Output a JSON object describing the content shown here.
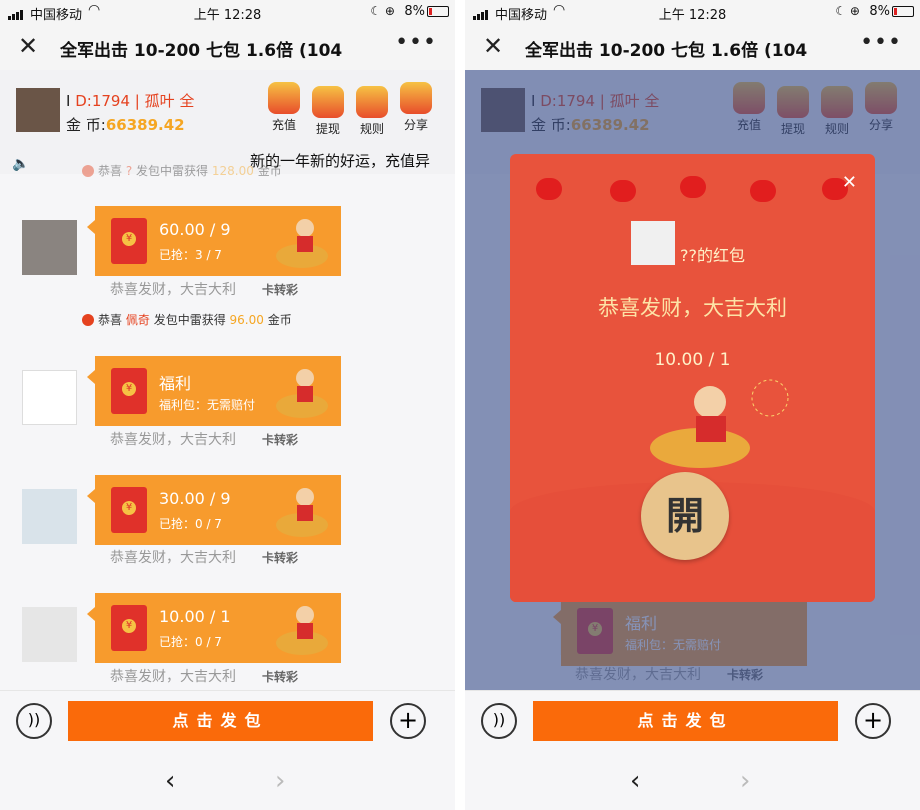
{
  "status": {
    "carrier": "中国移动",
    "time": "上午 12:28",
    "battery": "8%"
  },
  "header": {
    "title": "全军出击 10-200 七包 1.6倍 (104",
    "close_icon": "close-icon",
    "more_icon": "more-dots-icon"
  },
  "user": {
    "id_label": "I",
    "id_text": "D:1794 | 孤叶 全",
    "coins_label": "金 币:",
    "coins_value": "66389.42"
  },
  "toolbar": [
    {
      "label": "充值",
      "icon": "recharge-icon"
    },
    {
      "label": "提现",
      "icon": "withdraw-icon"
    },
    {
      "label": "规则",
      "icon": "rules-icon"
    },
    {
      "label": "分享",
      "icon": "share-icon"
    }
  ],
  "marquee": "新的一年新的好运，充值异",
  "notice_top": {
    "prefix": "恭喜",
    "name": "?",
    "mid": "发包中雷获得",
    "amount": "128.00",
    "unit": "金币"
  },
  "messages": [
    {
      "main": "60.00 / 9",
      "sub": "已抢：3 / 7",
      "foot": "恭喜发财，大吉大利",
      "wm": "卡转彩"
    },
    {
      "main": "福利",
      "sub": "福利包：无需赔付",
      "foot": "恭喜发财，大吉大利",
      "wm": "卡转彩"
    },
    {
      "main": "30.00 / 9",
      "sub": "已抢：0 / 7",
      "foot": "恭喜发财，大吉大利",
      "wm": "卡转彩"
    },
    {
      "main": "10.00 / 1",
      "sub": "已抢：0 / 7",
      "foot": "恭喜发财，大吉大利",
      "wm": "卡转彩"
    }
  ],
  "notice_mid": {
    "prefix": "恭喜",
    "name": "佩奇",
    "mid": "发包中雷获得",
    "amount": "96.00",
    "unit": "金币"
  },
  "bottom": {
    "send_label": "点击发包"
  },
  "modal": {
    "owner": "??的红包",
    "blessing": "恭喜发财，大吉大利",
    "amount": "10.00 / 1",
    "open_label": "開"
  },
  "colors": {
    "accent": "#fa6a0a",
    "bubble": "#f79b2d",
    "modal": "#e8533c",
    "red_text": "#e5421f"
  }
}
